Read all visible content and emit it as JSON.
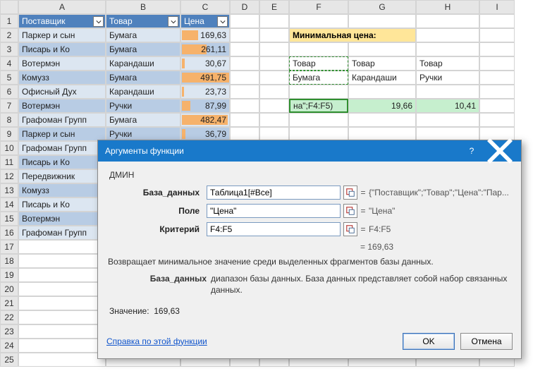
{
  "columns": [
    "A",
    "B",
    "C",
    "D",
    "E",
    "F",
    "G",
    "H",
    "I"
  ],
  "row_count": 25,
  "table_headers": {
    "a": "Поставщик",
    "b": "Товар",
    "c": "Цена"
  },
  "rows": [
    {
      "a": "Паркер и сын",
      "b": "Бумага",
      "c": "169,63",
      "bar": 34
    },
    {
      "a": "Писарь и Ко",
      "b": "Бумага",
      "c": "261,11",
      "bar": 52
    },
    {
      "a": "Вотермэн",
      "b": "Карандаши",
      "c": "30,67",
      "bar": 6
    },
    {
      "a": "Комузз",
      "b": "Бумага",
      "c": "491,75",
      "bar": 98
    },
    {
      "a": "Офисный Дух",
      "b": "Карандаши",
      "c": "23,73",
      "bar": 5
    },
    {
      "a": "Вотермэн",
      "b": "Ручки",
      "c": "87,99",
      "bar": 18
    },
    {
      "a": "Графоман Групп",
      "b": "Бумага",
      "c": "482,47",
      "bar": 96
    },
    {
      "a": "Паркер и сын",
      "b": "Ручки",
      "c": "36,79",
      "bar": 7
    },
    {
      "a": "Графоман Групп",
      "b": "",
      "c": "",
      "bar": 0
    },
    {
      "a": "Писарь и Ко",
      "b": "",
      "c": "",
      "bar": 0
    },
    {
      "a": "Передвижник",
      "b": "",
      "c": "",
      "bar": 0
    },
    {
      "a": "Комузз",
      "b": "",
      "c": "",
      "bar": 0
    },
    {
      "a": "Писарь и Ко",
      "b": "",
      "c": "",
      "bar": 0
    },
    {
      "a": "Вотермэн",
      "b": "",
      "c": "",
      "bar": 0
    },
    {
      "a": "Графоман Групп",
      "b": "",
      "c": "",
      "bar": 0
    }
  ],
  "side": {
    "title": "Минимальная цена:",
    "h": {
      "f": "Товар",
      "g": "Товар",
      "h": "Товар"
    },
    "v": {
      "f": "Бумага",
      "g": "Карандаши",
      "h": "Ручки"
    },
    "r": {
      "f": "на\";F4:F5)",
      "g": "19,66",
      "h": "10,41"
    }
  },
  "dialog": {
    "title": "Аргументы функции",
    "fn": "ДМИН",
    "args": {
      "db": {
        "label": "База_данных",
        "value": "Таблица1[#Все]",
        "preview": "{\"Поставщик\";\"Товар\";\"Цена\":\"Пар..."
      },
      "field": {
        "label": "Поле",
        "value": "\"Цена\"",
        "preview": "\"Цена\""
      },
      "crit": {
        "label": "Критерий",
        "value": "F4:F5",
        "preview": "F4:F5"
      }
    },
    "result_eq": "= 169,63",
    "desc": "Возвращает минимальное значение среди выделенных фрагментов базы данных.",
    "argname": "База_данных",
    "argdesc": "диапазон базы данных. База данных представляет собой набор связанных данных.",
    "value_label": "Значение:",
    "value": "169,63",
    "help": "Справка по этой функции",
    "ok": "OK",
    "cancel": "Отмена"
  },
  "chart_data": {
    "type": "table",
    "title": "Таблица1 — Поставщик / Товар / Цена",
    "columns": [
      "Поставщик",
      "Товар",
      "Цена"
    ],
    "rows": [
      [
        "Паркер и сын",
        "Бумага",
        169.63
      ],
      [
        "Писарь и Ко",
        "Бумага",
        261.11
      ],
      [
        "Вотермэн",
        "Карандаши",
        30.67
      ],
      [
        "Комузз",
        "Бумага",
        491.75
      ],
      [
        "Офисный Дух",
        "Карандаши",
        23.73
      ],
      [
        "Вотермэн",
        "Ручки",
        87.99
      ],
      [
        "Графоман Групп",
        "Бумага",
        482.47
      ],
      [
        "Паркер и сын",
        "Ручки",
        36.79
      ]
    ],
    "aggregate": {
      "function": "ДМИН",
      "field": "Цена",
      "by": "Товар",
      "result": {
        "Бумага": 169.63,
        "Карандаши": 19.66,
        "Ручки": 10.41
      }
    }
  }
}
